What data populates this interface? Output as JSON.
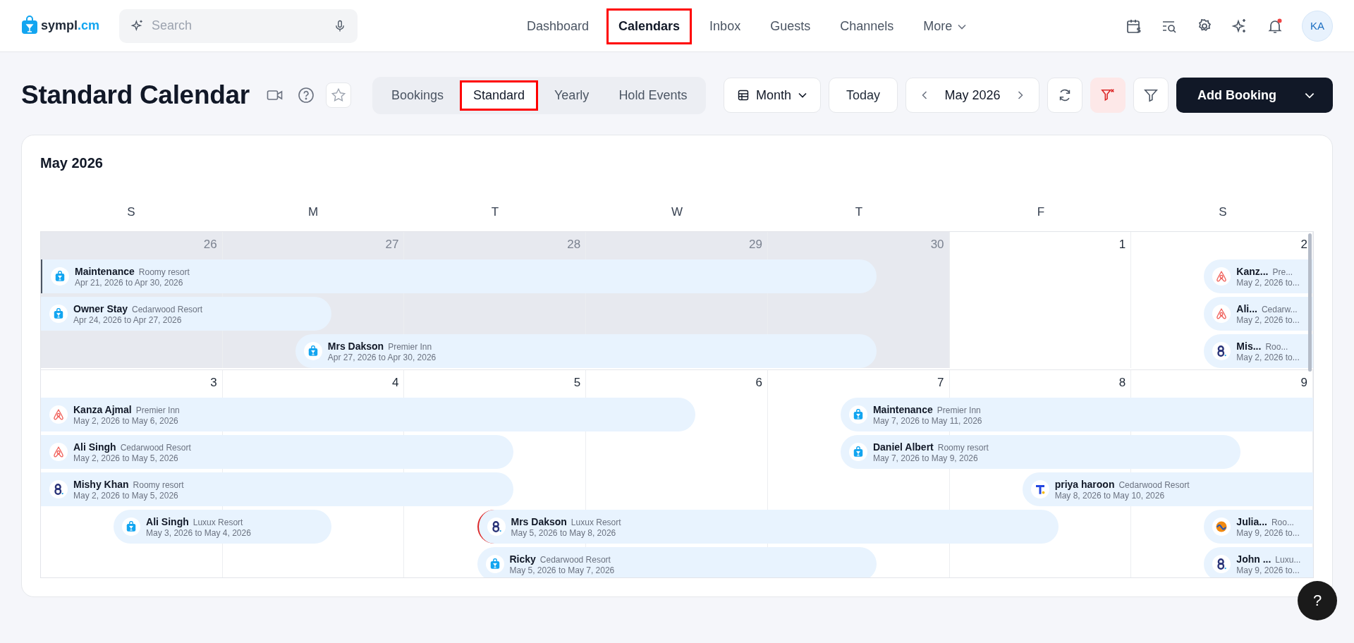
{
  "logo": {
    "name": "sympl",
    "suffix": ".cm"
  },
  "search": {
    "placeholder": "Search"
  },
  "nav": [
    {
      "label": "Dashboard",
      "selected": false,
      "outlined": false
    },
    {
      "label": "Calendars",
      "selected": true,
      "outlined": true
    },
    {
      "label": "Inbox",
      "selected": false,
      "outlined": false
    },
    {
      "label": "Guests",
      "selected": false,
      "outlined": false
    },
    {
      "label": "Channels",
      "selected": false,
      "outlined": false
    },
    {
      "label": "More",
      "selected": false,
      "outlined": false,
      "dropdown": true
    }
  ],
  "notifications": {
    "unread": true
  },
  "user": {
    "initials": "KA"
  },
  "page_title": "Standard Calendar",
  "view_tabs": [
    {
      "label": "Bookings",
      "selected": false,
      "outlined": false
    },
    {
      "label": "Standard",
      "selected": true,
      "outlined": true
    },
    {
      "label": "Yearly",
      "selected": false,
      "outlined": false
    },
    {
      "label": "Hold Events",
      "selected": false,
      "outlined": false
    }
  ],
  "toolbar": {
    "view": "Month",
    "today": "Today",
    "period": "May 2026",
    "filters_active": true,
    "add_button": "Add Booking"
  },
  "calendar": {
    "title": "May 2026",
    "weekdays": [
      "S",
      "M",
      "T",
      "W",
      "T",
      "F",
      "S"
    ],
    "weeks": [
      {
        "days": [
          {
            "label": "26",
            "other_month": true
          },
          {
            "label": "27",
            "other_month": true
          },
          {
            "label": "28",
            "other_month": true
          },
          {
            "label": "29",
            "other_month": true
          },
          {
            "label": "30",
            "other_month": true
          },
          {
            "label": "1",
            "other_month": false
          },
          {
            "label": "2",
            "other_month": false
          }
        ],
        "lanes": [
          [
            {
              "name": "Maintenance",
              "property": "Roomy resort",
              "dates": "Apr 21, 2026 to Apr 30, 2026",
              "kind": "bag",
              "focused": true,
              "flagged": false
            },
            {
              "name": "Kanz...",
              "property": "Pre...",
              "dates": "May 2, 2026 to...",
              "kind": "arch",
              "focused": false,
              "flagged": false
            }
          ],
          [
            {
              "name": "Owner Stay",
              "property": "Cedarwood Resort",
              "dates": "Apr 24, 2026 to Apr 27, 2026",
              "kind": "bag",
              "focused": false,
              "flagged": false
            },
            {
              "name": "Ali...",
              "property": "Cedarw...",
              "dates": "May 2, 2026 to...",
              "kind": "arch",
              "focused": false,
              "flagged": false
            }
          ],
          [
            {
              "name": "Mrs Dakson",
              "property": "Premier Inn",
              "dates": "Apr 27, 2026 to Apr 30, 2026",
              "kind": "bag",
              "focused": false,
              "flagged": false
            },
            {
              "name": "Mis...",
              "property": "Roo...",
              "dates": "May 2, 2026 to...",
              "kind": "rings",
              "focused": false,
              "flagged": false
            }
          ]
        ]
      },
      {
        "days": [
          {
            "label": "3",
            "other_month": false
          },
          {
            "label": "4",
            "other_month": false
          },
          {
            "label": "5",
            "other_month": false
          },
          {
            "label": "6",
            "other_month": false
          },
          {
            "label": "7",
            "other_month": false
          },
          {
            "label": "8",
            "other_month": false
          },
          {
            "label": "9",
            "other_month": false
          }
        ],
        "lanes": [
          [
            {
              "name": "Kanza Ajmal",
              "property": "Premier Inn",
              "dates": "May 2, 2026 to May 6, 2026",
              "kind": "arch",
              "focused": false,
              "flagged": false
            },
            {
              "name": "Maintenance",
              "property": "Premier Inn",
              "dates": "May 7, 2026 to May 11, 2026",
              "kind": "bag",
              "focused": false,
              "flagged": false
            }
          ],
          [
            {
              "name": "Ali Singh",
              "property": "Cedarwood Resort",
              "dates": "May 2, 2026 to May 5, 2026",
              "kind": "arch",
              "focused": false,
              "flagged": false
            },
            {
              "name": "Daniel Albert",
              "property": "Roomy resort",
              "dates": "May 7, 2026 to May 9, 2026",
              "kind": "bag",
              "focused": false,
              "flagged": false
            }
          ],
          [
            {
              "name": "Mishy Khan",
              "property": "Roomy resort",
              "dates": "May 2, 2026 to May 5, 2026",
              "kind": "rings",
              "focused": false,
              "flagged": false
            },
            {
              "name": "priya haroon",
              "property": "Cedarwood Resort",
              "dates": "May 8, 2026 to May 10, 2026",
              "kind": "tee",
              "focused": false,
              "flagged": false
            }
          ],
          [
            {
              "name": "Ali Singh",
              "property": "Luxux Resort",
              "dates": "May 3, 2026 to May 4, 2026",
              "kind": "bag",
              "focused": false,
              "flagged": false
            },
            {
              "name": "Mrs Dakson",
              "property": "Luxux Resort",
              "dates": "May 5, 2026 to May 8, 2026",
              "kind": "rings",
              "focused": false,
              "flagged": true
            },
            {
              "name": "Julia...",
              "property": "Roo...",
              "dates": "May 9, 2026 to...",
              "kind": "wave",
              "focused": false,
              "flagged": false
            }
          ],
          [
            {
              "name": "Ricky",
              "property": "Cedarwood Resort",
              "dates": "May 5, 2026 to May 7, 2026",
              "kind": "bag",
              "focused": false,
              "flagged": false
            },
            {
              "name": "John ...",
              "property": "Luxu...",
              "dates": "May 9, 2026 to...",
              "kind": "rings",
              "focused": false,
              "flagged": false
            }
          ]
        ]
      }
    ]
  },
  "help_button": {
    "label": "?"
  }
}
